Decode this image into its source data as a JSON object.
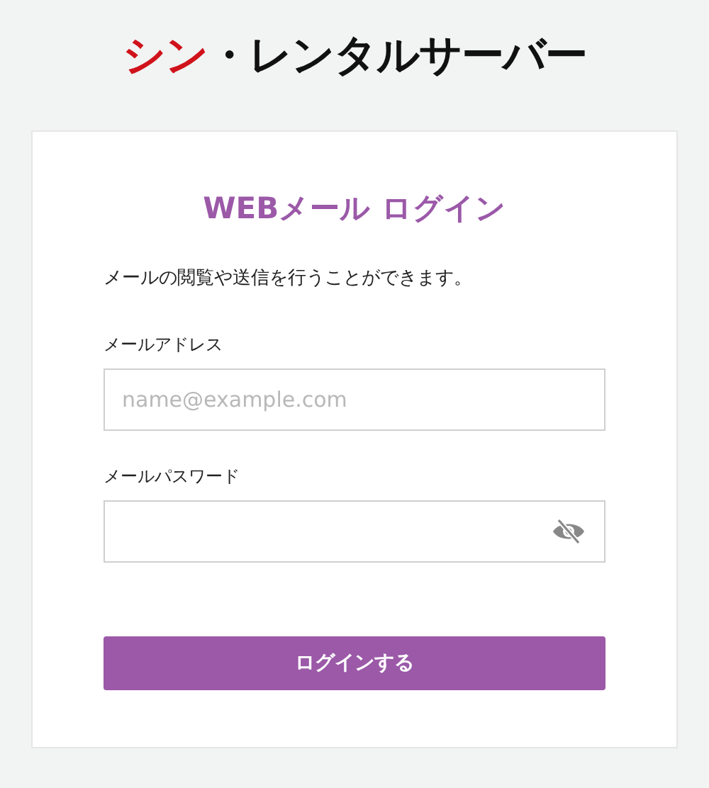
{
  "logo": {
    "parts": [
      {
        "text": "シン",
        "color": "#d0121b"
      },
      {
        "text": "・レンタルサーバー",
        "color": "#111111"
      }
    ]
  },
  "login": {
    "title": "WEBメール ログイン",
    "description": "メールの閲覧や送信を行うことができます。",
    "fields": [
      {
        "label": "メールアドレス",
        "placeholder": "name@example.com",
        "kind": "text"
      },
      {
        "label": "メールパスワード",
        "kind": "password",
        "password_hidden": true
      }
    ],
    "submit": "ログインする"
  }
}
